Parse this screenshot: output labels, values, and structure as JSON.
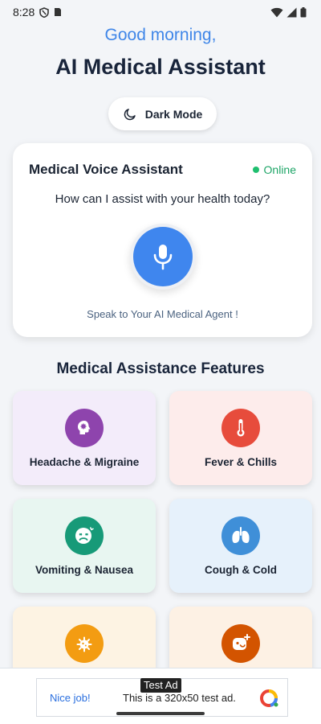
{
  "status_bar": {
    "time": "8:28"
  },
  "header": {
    "greeting": "Good morning,",
    "title": "AI Medical Assistant"
  },
  "dark_mode_button": {
    "label": "Dark Mode",
    "icon": "moon-icon"
  },
  "voice_card": {
    "title": "Medical Voice Assistant",
    "status": "Online",
    "status_color": "#1fbf6f",
    "question": "How can I assist with your health today?",
    "hint": "Speak to Your AI Medical Agent !",
    "mic_color": "#3f86ee"
  },
  "features": {
    "title": "Medical Assistance Features",
    "items": [
      {
        "label": "Headache & Migraine",
        "icon": "brain-icon",
        "icon_color": "#8e44ad",
        "bg": "#f3ecfa"
      },
      {
        "label": "Fever & Chills",
        "icon": "thermometer-icon",
        "icon_color": "#e74c3c",
        "bg": "#fdeceb"
      },
      {
        "label": "Vomiting & Nausea",
        "icon": "nauseous-face-icon",
        "icon_color": "#179a78",
        "bg": "#e8f6f1"
      },
      {
        "label": "Cough & Cold",
        "icon": "lungs-icon",
        "icon_color": "#3f8fd8",
        "bg": "#e6f1fb"
      },
      {
        "label": "",
        "icon": "virus-icon",
        "icon_color": "#f39c12",
        "bg": "#fdf3e3"
      },
      {
        "label": "",
        "icon": "face-icon",
        "icon_color": "#d35400",
        "bg": "#fdf1e4"
      }
    ]
  },
  "ad": {
    "tag": "Test Ad",
    "nice": "Nice job!",
    "text": "This is a 320x50 test ad."
  }
}
